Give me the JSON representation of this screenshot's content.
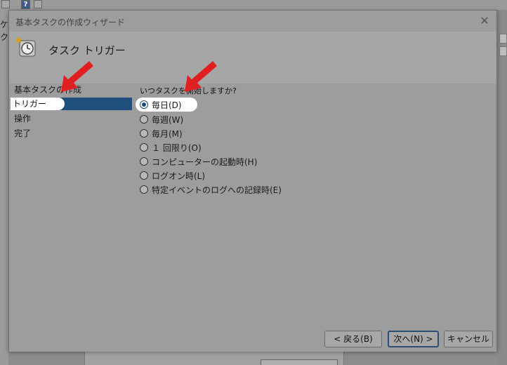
{
  "dialog": {
    "title": "基本タスクの作成ウィザード",
    "header_title": "タスク トリガー",
    "close_glyph": "✕"
  },
  "steps": [
    {
      "label": "基本タスクの作成"
    },
    {
      "label": "トリガー"
    },
    {
      "label": "操作"
    },
    {
      "label": "完了"
    }
  ],
  "question": "いつタスクを開始しますか?",
  "options": [
    {
      "label": "毎日(D)",
      "checked": true
    },
    {
      "label": "毎週(W)",
      "checked": false
    },
    {
      "label": "毎月(M)",
      "checked": false
    },
    {
      "label": "１ 回限り(O)",
      "checked": false
    },
    {
      "label": "コンピューターの起動時(H)",
      "checked": false
    },
    {
      "label": "ログオン時(L)",
      "checked": false
    },
    {
      "label": "特定イベントのログへの記録時(E)",
      "checked": false
    }
  ],
  "buttons": {
    "back": "< 戻る(B)",
    "next": "次へ(N) >",
    "cancel": "キャンセル"
  },
  "background": {
    "help_glyph": "?",
    "left_text_1": "ケ",
    "left_text_2": "ク"
  },
  "colors": {
    "accent": "#1f4f7a",
    "arrow": "#e02020"
  }
}
